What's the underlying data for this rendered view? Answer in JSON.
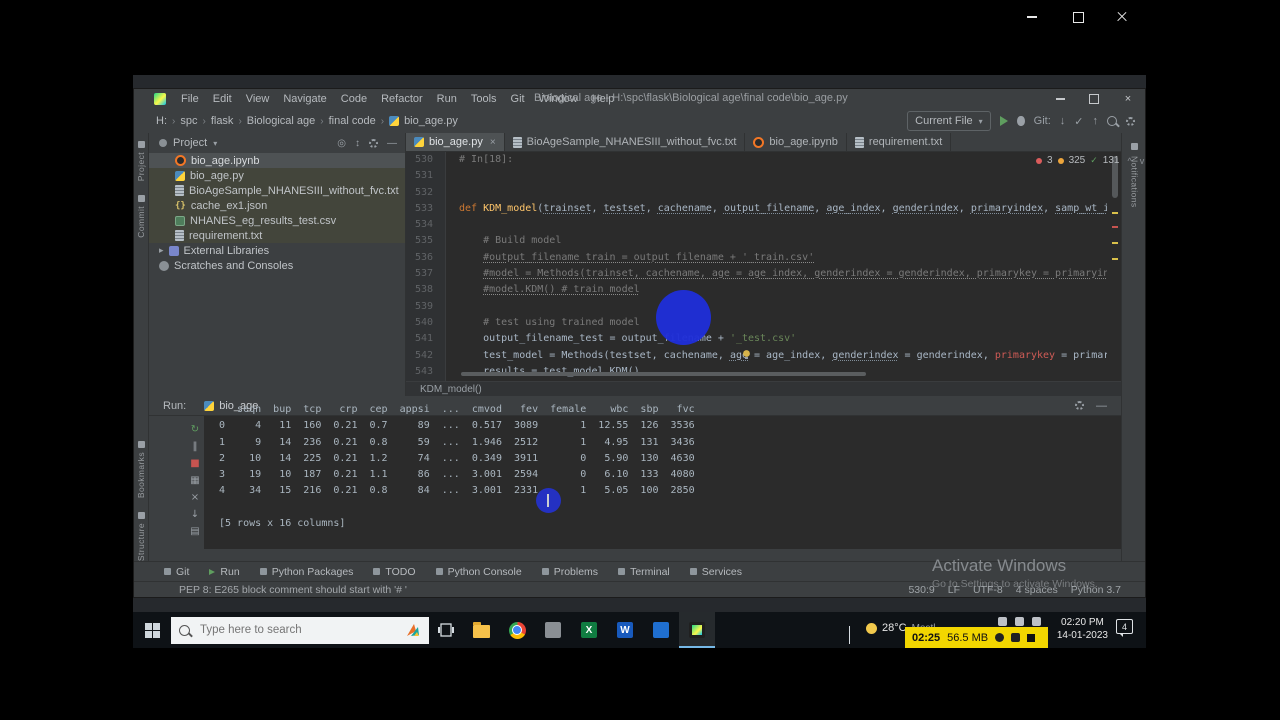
{
  "colors": {
    "panel_bg": "#3c3f41",
    "editor_bg": "#2b2b2b",
    "selection": "#4e5254",
    "taskbar_b g": "#0e1216",
    "recorder_yellow": "#f2d600",
    "cursor_highlight_blue": "#2333dd",
    "error_red": "#db5c5c",
    "warning_yellow": "#eda53c",
    "ok_green": "#5f9e5f"
  },
  "icons": {
    "close": "×",
    "crumb_sep": "›",
    "tree_chevron": "▸",
    "git_update": "↓",
    "git_commit": "✓",
    "git_push": "↑",
    "caret": "▾",
    "chevron_up": "^",
    "chevron_down": "v",
    "run_gutter": {
      "rerun-icon": "↻",
      "pause-icon": "‖",
      "stop-icon": "■",
      "restore-layout-icon": "▦",
      "clear-icon": "×",
      "scroll-to-end-icon": "↓",
      "print-icon": "▤"
    }
  },
  "titlebar": {
    "title": "Biological age - H:\\spc\\flask\\Biological age\\final code\\bio_age.py",
    "menus": [
      "File",
      "Edit",
      "View",
      "Navigate",
      "Code",
      "Refactor",
      "Run",
      "Tools",
      "Git",
      "Window",
      "Help"
    ]
  },
  "navbar": {
    "breadcrumbs": [
      "H:",
      "spc",
      "flask",
      "Biological age",
      "final code",
      "bio_age.py"
    ],
    "run_config": "Current File",
    "git_label": "Git:"
  },
  "left_stripe": {
    "top": [
      "Project",
      "Commit"
    ],
    "bottom": [
      "Bookmarks",
      "Structure"
    ]
  },
  "right_stripe": {
    "label": "Notifications"
  },
  "project": {
    "header": "Project",
    "items": [
      {
        "label": "bio_age.ipynb",
        "type": "ipynb",
        "selected": true
      },
      {
        "label": "bio_age.py",
        "type": "py",
        "band": true
      },
      {
        "label": "BioAgeSample_NHANESIII_without_fvc.txt",
        "type": "txt",
        "band": true
      },
      {
        "label": "cache_ex1.json",
        "type": "json",
        "band": true
      },
      {
        "label": "NHANES_eg_results_test.csv",
        "type": "csv",
        "band": true
      },
      {
        "label": "requirement.txt",
        "type": "txt",
        "band": true
      },
      {
        "label": "External Libraries",
        "type": "lib",
        "chevron": true
      },
      {
        "label": "Scratches and Consoles",
        "type": "scratch"
      }
    ]
  },
  "tabs": [
    {
      "label": "bio_age.py",
      "type": "py",
      "active": true,
      "closable": true
    },
    {
      "label": "BioAgeSample_NHANESIII_without_fvc.txt",
      "type": "txt"
    },
    {
      "label": "bio_age.ipynb",
      "type": "ipynb"
    },
    {
      "label": "requirement.txt",
      "type": "txt"
    }
  ],
  "inspections": {
    "errors": "3",
    "warnings": "325",
    "ok": "131"
  },
  "editor": {
    "breadcrumb": "KDM_model()",
    "lines": [
      {
        "num": "530",
        "tokens": [
          [
            "# In[18]:",
            "com"
          ]
        ]
      },
      {
        "num": "531",
        "tokens": []
      },
      {
        "num": "532",
        "tokens": []
      },
      {
        "num": "533",
        "tokens": [
          [
            "def ",
            "kw"
          ],
          [
            "KDM_model",
            "fn"
          ],
          [
            "(",
            "pl"
          ],
          [
            "trainset",
            "pm"
          ],
          [
            ", ",
            "pl"
          ],
          [
            "testset",
            "pm"
          ],
          [
            ", ",
            "pl"
          ],
          [
            "cachename",
            "pm"
          ],
          [
            ", ",
            "pl"
          ],
          [
            "output_filename",
            "pm"
          ],
          [
            ", ",
            "pl"
          ],
          [
            "age_index",
            "pm"
          ],
          [
            ", ",
            "pl"
          ],
          [
            "genderindex",
            "pm"
          ],
          [
            ", ",
            "pl"
          ],
          [
            "primaryindex",
            "pm"
          ],
          [
            ", ",
            "pl"
          ],
          [
            "samp_wt_ind",
            "pm"
          ]
        ]
      },
      {
        "num": "534",
        "tokens": []
      },
      {
        "num": "535",
        "tokens": [
          [
            "    # Build model",
            "com"
          ]
        ]
      },
      {
        "num": "536",
        "tokens": [
          [
            "    ",
            "pl"
          ],
          [
            "#output_filename_train = output_filename + '_train.csv'",
            "comu"
          ]
        ]
      },
      {
        "num": "537",
        "tokens": [
          [
            "    ",
            "pl"
          ],
          [
            "#model = Methods(trainset, cachename, age = age_index, genderindex = genderindex, primarykey = primaryindex",
            "comu"
          ]
        ]
      },
      {
        "num": "538",
        "tokens": [
          [
            "    ",
            "pl"
          ],
          [
            "#model.KDM() # train model",
            "comu"
          ]
        ]
      },
      {
        "num": "539",
        "tokens": []
      },
      {
        "num": "540",
        "tokens": [
          [
            "    # test using trained model",
            "com"
          ]
        ]
      },
      {
        "num": "541",
        "tokens": [
          [
            "    output_filename_test = output_filename + ",
            "pl"
          ],
          [
            "'_test.csv'",
            "str"
          ]
        ]
      },
      {
        "num": "542",
        "tokens": [
          [
            "    test_model = Methods(testset, cachename, ",
            "pl"
          ],
          [
            "age",
            "pm"
          ],
          [
            " = age_index, ",
            "pl"
          ],
          [
            "genderindex",
            "pm"
          ],
          [
            " = genderindex, ",
            "pl"
          ],
          [
            "primarykey",
            "err"
          ],
          [
            " = primaryindex)",
            "pl"
          ]
        ]
      },
      {
        "num": "543",
        "tokens": [
          [
            "    results = test_model.KDM()",
            "pl"
          ]
        ]
      }
    ]
  },
  "run": {
    "label": "Run:",
    "tab_label": "bio_age",
    "gutter_icons": [
      "rerun-icon",
      "pause-icon",
      "stop-icon",
      "restore-layout-icon",
      "clear-icon",
      "scroll-to-end-icon",
      "print-icon"
    ],
    "console_lines": [
      "   seqn  bup  tcp   crp  cep  appsi  ...  cmvod   fev  female    wbc  sbp   fvc",
      "0     4   11  160  0.21  0.7     89  ...  0.517  3089       1  12.55  126  3536",
      "1     9   14  236  0.21  0.8     59  ...  1.946  2512       1   4.95  131  3436",
      "2    10   14  225  0.21  1.2     74  ...  0.349  3911       0   5.90  130  4630",
      "3    19   10  187  0.21  1.1     86  ...  3.001  2594       0   6.10  133  4080",
      "4    34   15  216  0.21  0.8     84  ...  3.001  2331       1   5.05  100  2850",
      "",
      "[5 rows x 16 columns]"
    ]
  },
  "bottom_bar": {
    "items": [
      "Git",
      "Run",
      "Python Packages",
      "TODO",
      "Python Console",
      "Problems",
      "Terminal",
      "Services"
    ]
  },
  "status": {
    "message": "PEP 8: E265 block comment should start with '# '",
    "right": [
      "530:9",
      "LF",
      "UTF-8",
      "4 spaces",
      "Python 3.7"
    ]
  },
  "watermark": {
    "line1": "Activate Windows",
    "line2": "Go to Settings to activate Windows."
  },
  "taskbar": {
    "search_placeholder": "Type here to search",
    "weather_temp": "28°C",
    "weather_desc": "Mostl...",
    "recorder_time": "02:25",
    "recorder_size": "56.5 MB",
    "clock_time": "02:20 PM",
    "clock_date": "14-01-2023",
    "notification_count": "4"
  }
}
